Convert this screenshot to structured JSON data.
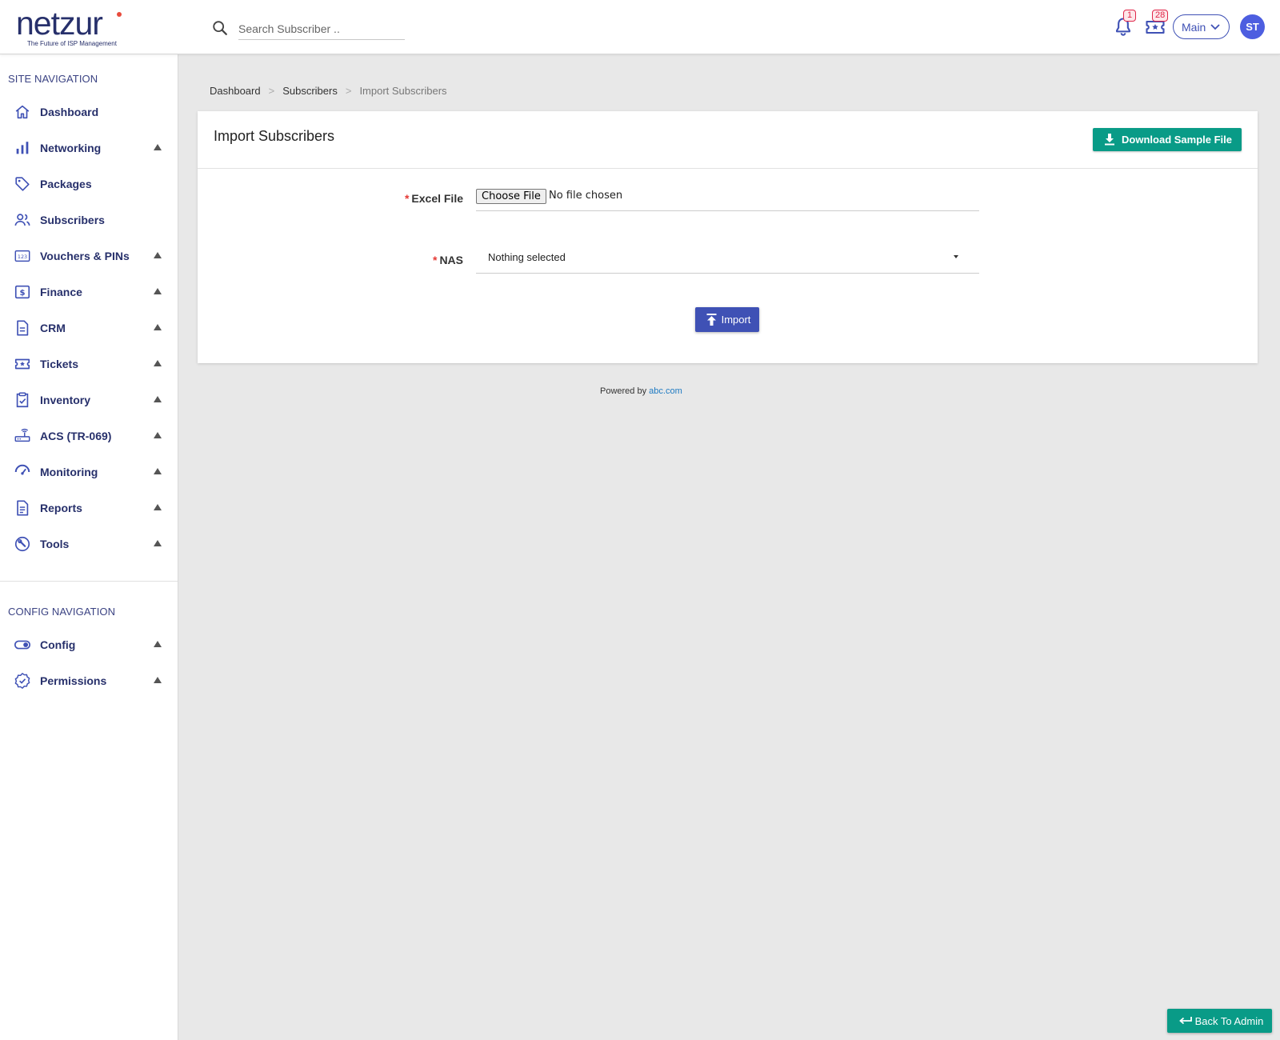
{
  "brand": {
    "logo_text": "netzur",
    "tagline": "The Future of ISP Management"
  },
  "header": {
    "search_placeholder": "Search Subscriber ..",
    "notifications_count": "1",
    "tickets_count": "28",
    "branch_label": "Main",
    "avatar_initials": "ST"
  },
  "sidebar": {
    "site_heading": "SITE NAVIGATION",
    "config_heading": "CONFIG NAVIGATION",
    "items": [
      {
        "label": "Dashboard",
        "icon": "home-icon",
        "expandable": false
      },
      {
        "label": "Networking",
        "icon": "bar-chart-icon",
        "expandable": true
      },
      {
        "label": "Packages",
        "icon": "tag-icon",
        "expandable": false
      },
      {
        "label": "Subscribers",
        "icon": "users-icon",
        "expandable": false
      },
      {
        "label": "Vouchers & PINs",
        "icon": "numeric-icon",
        "expandable": true
      },
      {
        "label": "Finance",
        "icon": "dollar-icon",
        "expandable": true
      },
      {
        "label": "CRM",
        "icon": "document-icon",
        "expandable": true
      },
      {
        "label": "Tickets",
        "icon": "ticket-star-icon",
        "expandable": true
      },
      {
        "label": "Inventory",
        "icon": "clipboard-check-icon",
        "expandable": true
      },
      {
        "label": "ACS (TR-069)",
        "icon": "router-icon",
        "expandable": true
      },
      {
        "label": "Monitoring",
        "icon": "speedometer-icon",
        "expandable": true
      },
      {
        "label": "Reports",
        "icon": "report-icon",
        "expandable": true
      },
      {
        "label": "Tools",
        "icon": "wrench-icon",
        "expandable": true
      }
    ],
    "config_items": [
      {
        "label": "Config",
        "icon": "toggle-icon",
        "expandable": true
      },
      {
        "label": "Permissions",
        "icon": "badge-check-icon",
        "expandable": true
      }
    ]
  },
  "breadcrumb": {
    "items": [
      "Dashboard",
      "Subscribers"
    ],
    "current": "Import Subscribers",
    "separator": ">"
  },
  "card": {
    "title": "Import Subscribers",
    "download_label": "Download Sample File",
    "excel_label": "Excel File",
    "required_mark": "*",
    "file_button_label": "Choose File",
    "file_status": "No file chosen",
    "nas_label": "NAS",
    "nas_value": "Nothing selected",
    "import_label": "Import"
  },
  "footer": {
    "powered_by": "Powered by",
    "link_text": "abc.com"
  },
  "back_to_admin_label": "Back To Admin",
  "colors": {
    "primary": "#3f51b5",
    "teal": "#099b87",
    "nav_text": "#27306b",
    "badge_red": "#e0274a",
    "background": "#e8e8e8"
  }
}
